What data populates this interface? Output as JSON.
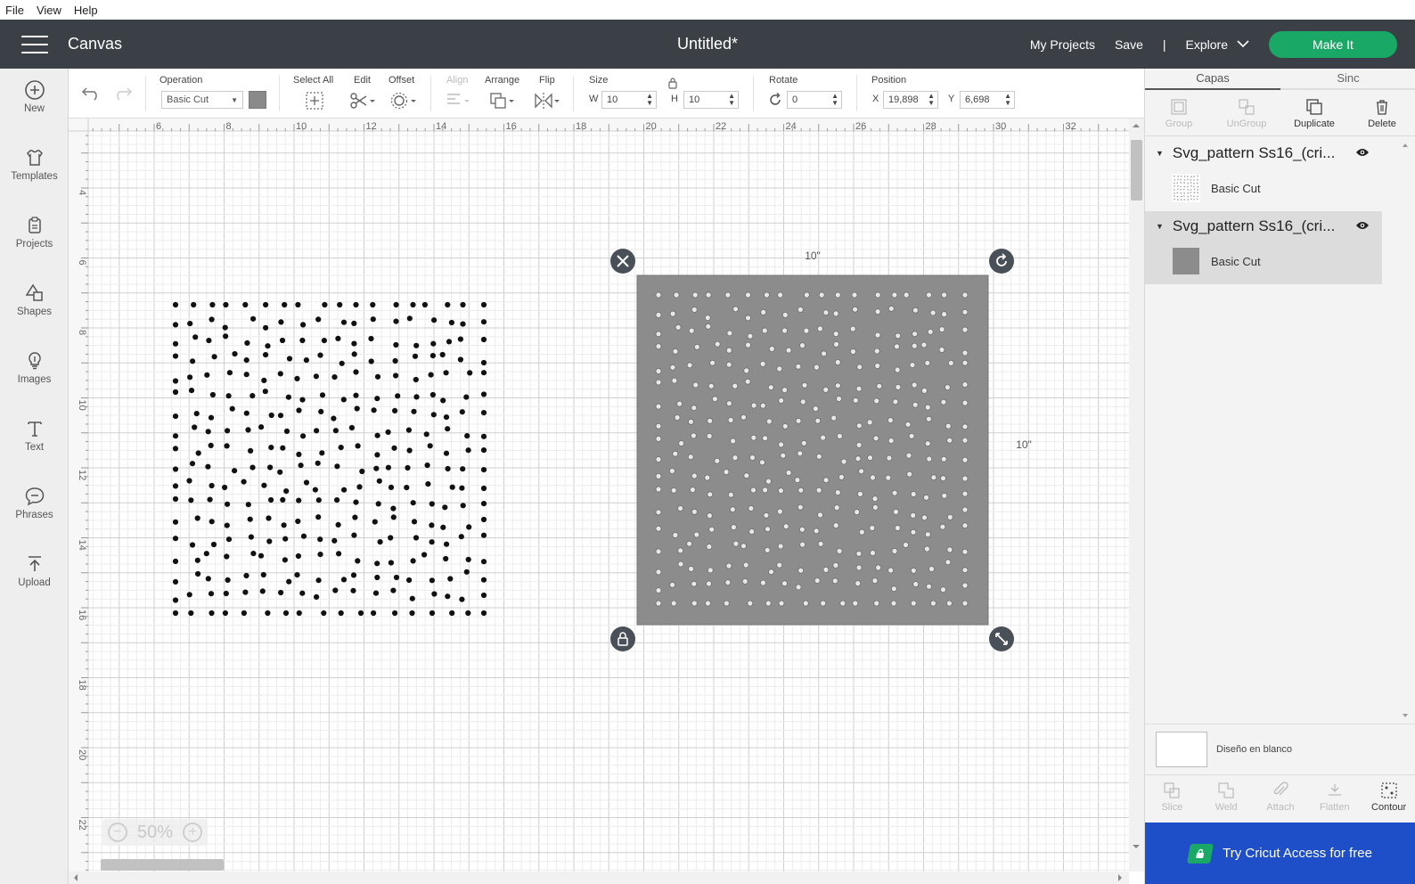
{
  "menubar": {
    "file": "File",
    "view": "View",
    "help": "Help"
  },
  "header": {
    "app_name": "Canvas",
    "doc_title": "Untitled*",
    "my_projects": "My Projects",
    "save": "Save",
    "separator": "|",
    "explore": "Explore",
    "make_it": "Make It"
  },
  "sidebar": {
    "items": [
      {
        "label": "New",
        "icon": "plus-circle-icon"
      },
      {
        "label": "Templates",
        "icon": "shirt-icon"
      },
      {
        "label": "Projects",
        "icon": "projects-icon"
      },
      {
        "label": "Shapes",
        "icon": "shapes-icon"
      },
      {
        "label": "Images",
        "icon": "lightbulb-icon"
      },
      {
        "label": "Text",
        "icon": "text-icon"
      },
      {
        "label": "Phrases",
        "icon": "speech-bubble-icon"
      },
      {
        "label": "Upload",
        "icon": "upload-icon"
      }
    ]
  },
  "toolbar": {
    "operation_label": "Operation",
    "operation_value": "Basic Cut",
    "operation_color": "#8a8a8a",
    "select_all": "Select All",
    "edit": "Edit",
    "offset": "Offset",
    "align": "Align",
    "arrange": "Arrange",
    "flip": "Flip",
    "size_label": "Size",
    "w_prefix": "W",
    "w_value": "10",
    "h_prefix": "H",
    "h_value": "10",
    "rotate_label": "Rotate",
    "rotate_value": "0",
    "position_label": "Position",
    "x_prefix": "X",
    "x_value": "19,898",
    "y_prefix": "Y",
    "y_value": "6,698"
  },
  "canvas": {
    "ruler_h": [
      "6",
      "8",
      "10",
      "12",
      "14",
      "16",
      "18",
      "20",
      "22",
      "24",
      "26",
      "28",
      "30",
      "32"
    ],
    "ruler_v": [
      "4",
      "6",
      "8",
      "10",
      "12",
      "14",
      "16",
      "18",
      "20",
      "22"
    ],
    "width_label": "10\"",
    "height_label": "10\"",
    "zoom": "50%",
    "shape_fill": "#8c8c8c"
  },
  "panel": {
    "tabs": [
      "Capas",
      "Sinc"
    ],
    "actions": [
      {
        "label": "Group",
        "enabled": false,
        "icon": "group-icon"
      },
      {
        "label": "UnGroup",
        "enabled": false,
        "icon": "ungroup-icon"
      },
      {
        "label": "Duplicate",
        "enabled": true,
        "icon": "duplicate-icon"
      },
      {
        "label": "Delete",
        "enabled": true,
        "icon": "trash-icon"
      }
    ],
    "layers": [
      {
        "name": "Svg_pattern Ss16_(cri...",
        "operation": "Basic Cut"
      },
      {
        "name": "Svg_pattern Ss16_(cri...",
        "operation": "Basic Cut"
      }
    ],
    "blank_label": "Diseño en blanco",
    "bottom_actions": [
      {
        "label": "Slice",
        "enabled": false,
        "icon": "slice-icon"
      },
      {
        "label": "Weld",
        "enabled": false,
        "icon": "weld-icon"
      },
      {
        "label": "Attach",
        "enabled": false,
        "icon": "attach-icon"
      },
      {
        "label": "Flatten",
        "enabled": false,
        "icon": "flatten-icon"
      },
      {
        "label": "Contour",
        "enabled": true,
        "icon": "contour-icon"
      }
    ],
    "cta": "Try Cricut Access for free",
    "cta_color": "#1e4fc9"
  }
}
